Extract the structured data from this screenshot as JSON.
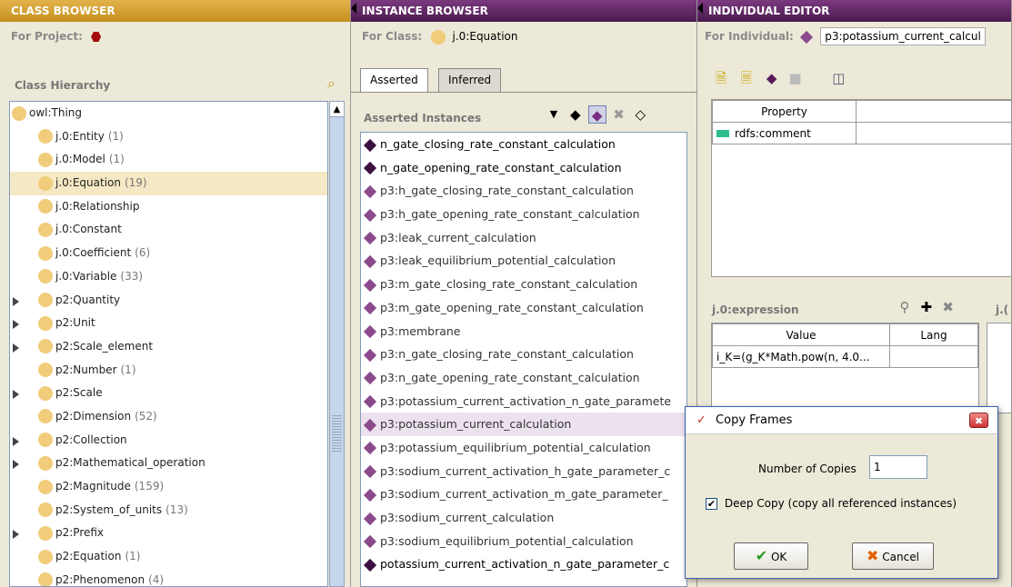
{
  "class_browser": {
    "banner": "CLASS BROWSER",
    "for_project_label": "For Project:",
    "hierarchy_label": "Class Hierarchy",
    "items": [
      {
        "label": "owl:Thing",
        "count": "",
        "expander": false,
        "indent": 0,
        "selected": false
      },
      {
        "label": "j.0:Entity",
        "count": "(1)",
        "expander": false,
        "indent": 1,
        "selected": false
      },
      {
        "label": "j.0:Model",
        "count": "(1)",
        "expander": false,
        "indent": 1,
        "selected": false
      },
      {
        "label": "j.0:Equation",
        "count": "(19)",
        "expander": false,
        "indent": 1,
        "selected": true
      },
      {
        "label": "j.0:Relationship",
        "count": "",
        "expander": false,
        "indent": 1,
        "selected": false
      },
      {
        "label": "j.0:Constant",
        "count": "",
        "expander": false,
        "indent": 1,
        "selected": false
      },
      {
        "label": "j.0:Coefficient",
        "count": "(6)",
        "expander": false,
        "indent": 1,
        "selected": false
      },
      {
        "label": "j.0:Variable",
        "count": "(33)",
        "expander": false,
        "indent": 1,
        "selected": false
      },
      {
        "label": "p2:Quantity",
        "count": "",
        "expander": true,
        "indent": 1,
        "selected": false
      },
      {
        "label": "p2:Unit",
        "count": "",
        "expander": true,
        "indent": 1,
        "selected": false
      },
      {
        "label": "p2:Scale_element",
        "count": "",
        "expander": true,
        "indent": 1,
        "selected": false
      },
      {
        "label": "p2:Number",
        "count": "(1)",
        "expander": false,
        "indent": 1,
        "selected": false
      },
      {
        "label": "p2:Scale",
        "count": "",
        "expander": true,
        "indent": 1,
        "selected": false
      },
      {
        "label": "p2:Dimension",
        "count": "(52)",
        "expander": false,
        "indent": 1,
        "selected": false
      },
      {
        "label": "p2:Collection",
        "count": "",
        "expander": true,
        "indent": 1,
        "selected": false
      },
      {
        "label": "p2:Mathematical_operation",
        "count": "",
        "expander": true,
        "indent": 1,
        "selected": false
      },
      {
        "label": "p2:Magnitude",
        "count": "(159)",
        "expander": false,
        "indent": 1,
        "selected": false
      },
      {
        "label": "p2:System_of_units",
        "count": "(13)",
        "expander": false,
        "indent": 1,
        "selected": false
      },
      {
        "label": "p2:Prefix",
        "count": "",
        "expander": true,
        "indent": 1,
        "selected": false
      },
      {
        "label": "p2:Equation",
        "count": "(1)",
        "expander": false,
        "indent": 1,
        "selected": false
      },
      {
        "label": "p2:Phenomenon",
        "count": "(4)",
        "expander": false,
        "indent": 1,
        "selected": false
      }
    ]
  },
  "instance_browser": {
    "banner": "INSTANCE BROWSER",
    "for_class_label": "For Class:",
    "for_class_value": "j.0:Equation",
    "tabs": [
      "Asserted",
      "Inferred"
    ],
    "list_title": "Asserted Instances",
    "instances": [
      {
        "label": "n_gate_closing_rate_constant_calculation",
        "dark": true,
        "selected": false
      },
      {
        "label": "n_gate_opening_rate_constant_calculation",
        "dark": true,
        "selected": false
      },
      {
        "label": "p3:h_gate_closing_rate_constant_calculation",
        "dark": false,
        "selected": false
      },
      {
        "label": "p3:h_gate_opening_rate_constant_calculation",
        "dark": false,
        "selected": false
      },
      {
        "label": "p3:leak_current_calculation",
        "dark": false,
        "selected": false
      },
      {
        "label": "p3:leak_equilibrium_potential_calculation",
        "dark": false,
        "selected": false
      },
      {
        "label": "p3:m_gate_closing_rate_constant_calculation",
        "dark": false,
        "selected": false
      },
      {
        "label": "p3:m_gate_opening_rate_constant_calculation",
        "dark": false,
        "selected": false
      },
      {
        "label": "p3:membrane",
        "dark": false,
        "selected": false
      },
      {
        "label": "p3:n_gate_closing_rate_constant_calculation",
        "dark": false,
        "selected": false
      },
      {
        "label": "p3:n_gate_opening_rate_constant_calculation",
        "dark": false,
        "selected": false
      },
      {
        "label": "p3:potassium_current_activation_n_gate_paramete",
        "dark": false,
        "selected": false
      },
      {
        "label": "p3:potassium_current_calculation",
        "dark": false,
        "selected": true
      },
      {
        "label": "p3:potassium_equilibrium_potential_calculation",
        "dark": false,
        "selected": false
      },
      {
        "label": "p3:sodium_current_activation_h_gate_parameter_c",
        "dark": false,
        "selected": false
      },
      {
        "label": "p3:sodium_current_activation_m_gate_parameter_",
        "dark": false,
        "selected": false
      },
      {
        "label": "p3:sodium_current_calculation",
        "dark": false,
        "selected": false
      },
      {
        "label": "p3:sodium_equilibrium_potential_calculation",
        "dark": false,
        "selected": false
      },
      {
        "label": "potassium_current_activation_n_gate_parameter_c",
        "dark": true,
        "selected": false
      }
    ]
  },
  "individual_editor": {
    "banner": "INDIVIDUAL EDITOR",
    "for_individual_label": "For Individual:",
    "for_individual_value": "p3:potassium_current_calcul",
    "property_header": "Property",
    "properties": [
      "rdfs:comment"
    ],
    "expression_label": "j.0:expression",
    "value_header": "Value",
    "lang_header": "Lang",
    "expression_value": "i_K=(g_K*Math.pow(n, 4.0...",
    "side_label": "j.("
  },
  "dialog": {
    "title": "Copy Frames",
    "copies_label": "Number of Copies",
    "copies_value": "1",
    "deep_copy_label": "Deep Copy (copy all referenced instances)",
    "deep_copy_checked": true,
    "ok_label": "OK",
    "cancel_label": "Cancel"
  }
}
